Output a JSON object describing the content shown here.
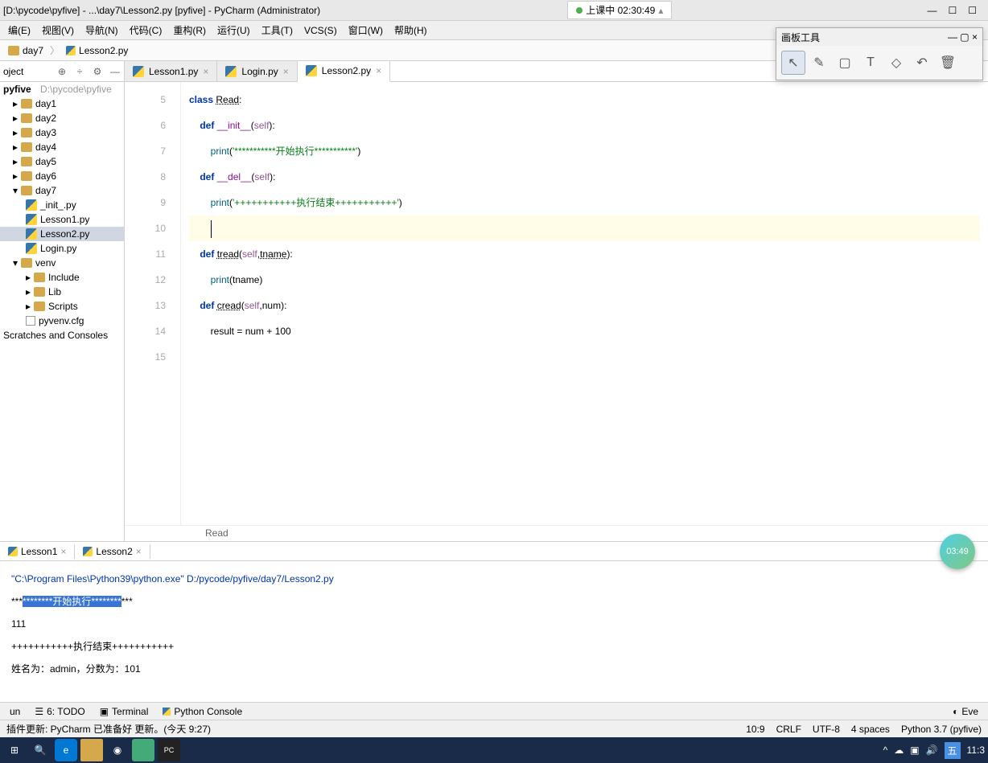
{
  "title": "[D:\\pycode\\pyfive] - ...\\day7\\Lesson2.py [pyfive] - PyCharm (Administrator)",
  "recording": {
    "label": "上课中 02:30:49"
  },
  "menu": [
    "编(E)",
    "视图(V)",
    "导航(N)",
    "代码(C)",
    "重构(R)",
    "运行(U)",
    "工具(T)",
    "VCS(S)",
    "窗口(W)",
    "帮助(H)"
  ],
  "crumbs": [
    "day7",
    "Lesson2.py"
  ],
  "drawpanel": {
    "title": "画板工具"
  },
  "proj": {
    "hdr": "oject",
    "root": {
      "name": "pyfive",
      "path": "D:\\pycode\\pyfive"
    },
    "dirs": [
      "day1",
      "day2",
      "day3",
      "day4",
      "day5",
      "day6",
      "day7"
    ],
    "day7files": [
      "_init_.py",
      "Lesson1.py",
      "Lesson2.py",
      "Login.py"
    ],
    "venv": {
      "name": "venv",
      "items": [
        "Include",
        "Lib",
        "Scripts",
        "pyvenv.cfg"
      ]
    },
    "scratch": "Scratches and Consoles"
  },
  "tabs": [
    "Lesson1.py",
    "Login.py",
    "Lesson2.py"
  ],
  "active_tab": 2,
  "code_lines": [
    5,
    6,
    7,
    8,
    9,
    10,
    11,
    12,
    13,
    14,
    15
  ],
  "code": {
    "class_kw": "class",
    "class_name": "Read",
    "def_kw": "def",
    "init": "__init__",
    "del": "__del__",
    "self": "self",
    "print": "print",
    "str1": "'***********开始执行***********'",
    "str2": "'+++++++++++执行结束+++++++++++'",
    "tread": "tread",
    "tname": "tname",
    "cread": "cread",
    "num": "num",
    "result_line": "result = num + 100"
  },
  "breadcrumb": "Read",
  "run_tabs": [
    "Lesson1",
    "Lesson2"
  ],
  "output": {
    "cmd": "\"C:\\Program Files\\Python39\\python.exe\" D:/pycode/pyfive/day7/Lesson2.py",
    "l1a": "***",
    "l1b": "********开始执行********",
    "l1c": "***",
    "l2": "111",
    "l3": "+++++++++++执行结束+++++++++++",
    "l4": "姓名为：admin，分数为：101"
  },
  "bot_tabs": {
    "run": "un",
    "todo": "6: TODO",
    "term": "Terminal",
    "py": "Python Console",
    "ev": "Eve"
  },
  "status": {
    "left": "插件更新: PyCharm 已准备好 更新。(今天 9:27)",
    "pos": "10:9",
    "eol": "CRLF",
    "enc": "UTF-8",
    "indent": "4 spaces",
    "interp": "Python 3.7 (pyfive)"
  },
  "taskbar": {
    "time": "11:3",
    "ime": "五"
  },
  "badge": "03:49"
}
